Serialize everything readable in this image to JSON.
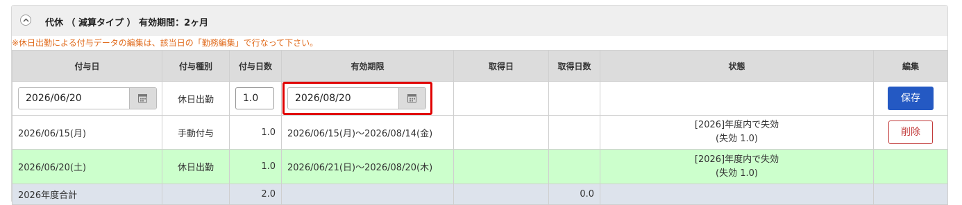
{
  "header": {
    "title": "代休 （ 減算タイプ ） 有効期間：2ヶ月"
  },
  "notice": "※休日出勤による付与データの編集は、該当日の「勤務編集」で行なって下さい。",
  "table": {
    "columns": [
      "付与日",
      "付与種別",
      "付与日数",
      "有効期限",
      "取得日",
      "取得日数",
      "状態",
      "編集"
    ],
    "edit_row": {
      "grant_date": "2026/06/20",
      "grant_type": "休日出勤",
      "grant_days": "1.0",
      "expiry_date": "2026/08/20",
      "save_label": "保存"
    },
    "rows": [
      {
        "grant_date": "2026/06/15(月)",
        "grant_type": "手動付与",
        "grant_days": "1.0",
        "period": "2026/06/15(月)～2026/08/14(金)",
        "status_line1": "[2026]年度内で失効",
        "status_line2": "(失効 1.0)",
        "delete_label": "削除"
      },
      {
        "grant_date": "2026/06/20(土)",
        "grant_type": "休日出勤",
        "grant_days": "1.0",
        "period": "2026/06/21(日)～2026/08/20(木)",
        "status_line1": "[2026]年度内で失効",
        "status_line2": "(失効 1.0)"
      }
    ],
    "total": {
      "label": "2026年度合計",
      "grant_days": "2.0",
      "taken_days": "0.0"
    }
  },
  "colors": {
    "save_button": "#2459c3",
    "delete_button": "#c23b3b",
    "notice_text": "#e06a1b",
    "highlight_row": "#ccffcc",
    "total_row": "#dde3ec",
    "focus_border": "#e00000"
  }
}
